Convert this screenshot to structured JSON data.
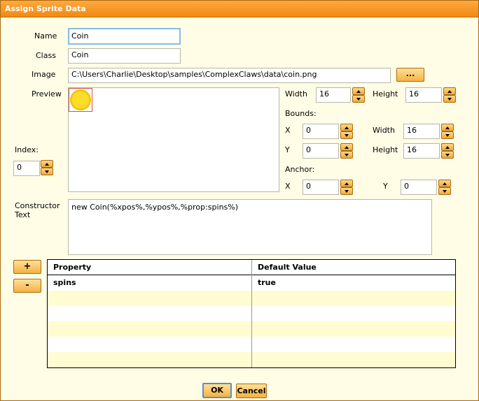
{
  "dialog": {
    "title": "Assign Sprite Data"
  },
  "form": {
    "name_label": "Name",
    "name_value": "Coin",
    "class_label": "Class",
    "class_value": "Coin",
    "image_label": "Image",
    "image_value": "C:\\Users\\Charlie\\Desktop\\samples\\ComplexClaws\\data\\coin.png",
    "browse_label": "...",
    "preview_label": "Preview",
    "index_label": "Index:",
    "index_value": "0",
    "width_label": "Width",
    "width_value": "16",
    "height_label": "Height",
    "height_value": "16",
    "bounds_label": "Bounds:",
    "bounds_x_label": "X",
    "bounds_x_value": "0",
    "bounds_width_label": "Width",
    "bounds_width_value": "16",
    "bounds_y_label": "Y",
    "bounds_y_value": "0",
    "bounds_height_label": "Height",
    "bounds_height_value": "16",
    "anchor_label": "Anchor:",
    "anchor_x_label": "X",
    "anchor_x_value": "0",
    "anchor_y_label": "Y",
    "anchor_y_value": "0",
    "constructor_label_1": "Constructor",
    "constructor_label_2": "Text",
    "constructor_value": "new Coin(%xpos%,%ypos%,%prop:spins%)"
  },
  "properties": {
    "add_label": "+",
    "remove_label": "-",
    "columns": [
      "Property",
      "Default Value"
    ],
    "rows": [
      {
        "property": "spins",
        "default_value": "true"
      }
    ]
  },
  "footer": {
    "ok_label": "OK",
    "cancel_label": "Cancel"
  },
  "colors": {
    "title_bar": "#f59a25",
    "background": "#fffde6",
    "alt_row": "#fffcd2",
    "button_fill": "#f5b142",
    "focus_border": "#86bbe6"
  },
  "icons": {
    "preview": "coin-icon",
    "spinner_up": "arrow-up-icon",
    "spinner_down": "arrow-down-icon"
  }
}
